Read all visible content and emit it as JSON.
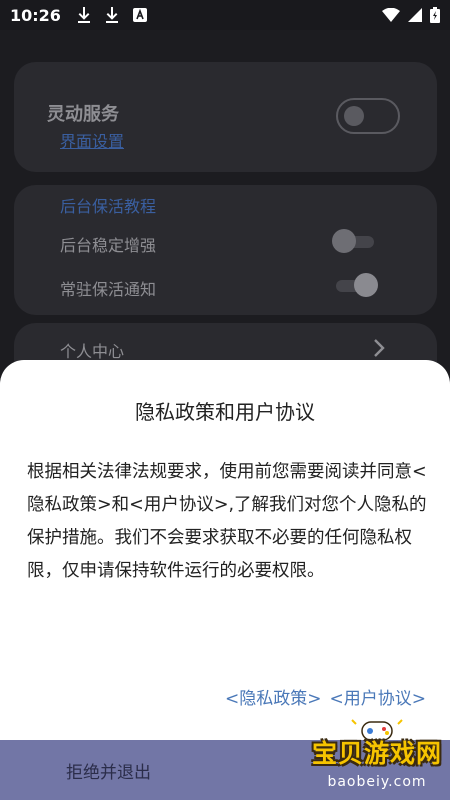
{
  "status_bar": {
    "time": "10:26",
    "left_icons": [
      "download-icon",
      "download-icon",
      "text-a-icon"
    ],
    "right_icons": [
      "wifi-icon",
      "signal-icon",
      "battery-icon"
    ]
  },
  "background": {
    "service_card": {
      "title": "灵动服务",
      "link": "界面设置",
      "toggle_on": false
    },
    "keepalive_card": {
      "heading": "后台保活教程",
      "rows": [
        {
          "label": "后台稳定增强",
          "toggle_on": false
        },
        {
          "label": "常驻保活通知",
          "toggle_on": true
        }
      ]
    },
    "personal_card": {
      "label": "个人中心",
      "icon": "chevron-right-icon"
    }
  },
  "dialog": {
    "title": "隐私政策和用户协议",
    "body": "根据相关法律法规要求，使用前您需要阅读并同意<隐私政策>和<用户协议>,了解我们对您个人隐私的保护措施。我们不会要求获取不必要的任何隐私权限，仅申请保持软件运行的必要权限。",
    "privacy_link": "<隐私政策>",
    "agreement_link": "<用户协议>"
  },
  "actions": {
    "reject_label": "拒绝并退出"
  },
  "watermark": {
    "text": "宝贝游戏网",
    "url": "baobeiy.com"
  },
  "colors": {
    "background": "#1c1c20",
    "card": "#2a2a2f",
    "accent_link": "#3a5fa0",
    "sheet_link": "#4a78b8",
    "action_bar": "#7276a6",
    "watermark": "#f6c400"
  }
}
